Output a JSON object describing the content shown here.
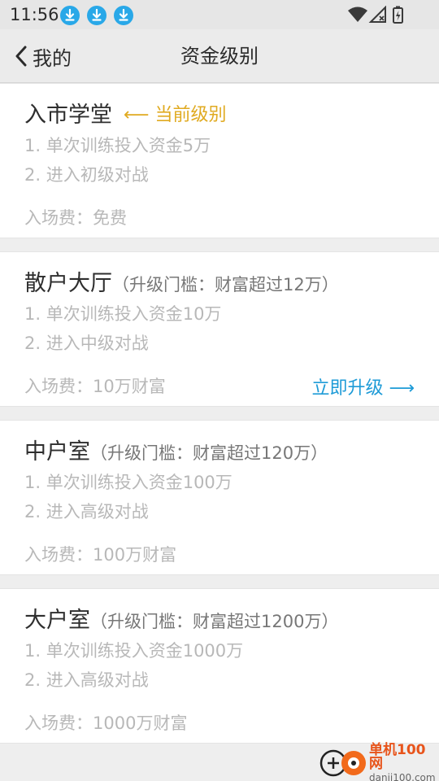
{
  "status_bar": {
    "time": "11:56",
    "icons": [
      "download-icon",
      "download-icon",
      "download-icon",
      "wifi-icon",
      "no-signal-icon",
      "battery-charging-icon"
    ]
  },
  "nav": {
    "back_label": "我的",
    "title": "资金级别"
  },
  "colors": {
    "accent_blue": "#1e9bd7",
    "current_gold": "#e0aa20",
    "download_blue": "#29a8e8"
  },
  "levels": [
    {
      "name": "入市学堂",
      "threshold": "",
      "current_tag": "⟵ 当前级别",
      "rule1": "1. 单次训练投入资金5万",
      "rule2": "2. 进入初级对战",
      "fee": "入场费：免费",
      "action": ""
    },
    {
      "name": "散户大厅",
      "threshold": "（升级门槛：财富超过12万）",
      "current_tag": "",
      "rule1": "1. 单次训练投入资金10万",
      "rule2": "2. 进入中级对战",
      "fee": "入场费：10万财富",
      "action": "立即升级 ⟶"
    },
    {
      "name": "中户室",
      "threshold": "（升级门槛：财富超过120万）",
      "current_tag": "",
      "rule1": "1. 单次训练投入资金100万",
      "rule2": "2. 进入高级对战",
      "fee": "入场费：100万财富",
      "action": ""
    },
    {
      "name": "大户室",
      "threshold": "（升级门槛：财富超过1200万）",
      "current_tag": "",
      "rule1": "1. 单次训练投入资金1000万",
      "rule2": "2. 进入高级对战",
      "fee": "入场费：1000万财富",
      "action": ""
    }
  ],
  "watermark": {
    "cn": "单机100网",
    "en": "danji100.com"
  }
}
